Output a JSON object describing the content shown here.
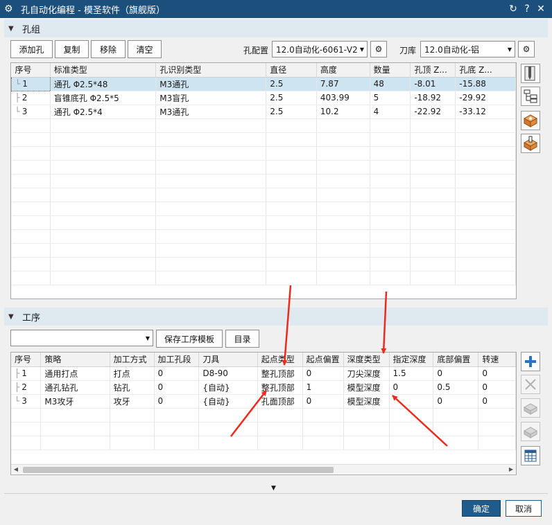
{
  "window": {
    "title": "孔自动化编程 - 模圣软件（旗舰版）",
    "app_icon": "gear-icon",
    "buttons": [
      "reset-icon",
      "help-icon",
      "close-icon"
    ]
  },
  "hole_group": {
    "section_label": "孔组",
    "buttons": {
      "add": "添加孔",
      "copy": "复制",
      "remove": "移除",
      "clear": "清空"
    },
    "config_label": "孔配置",
    "config_value": "12.0自动化-6061-V2",
    "tool_lib_label": "刀库",
    "tool_lib_value": "12.0自动化-铝",
    "columns": [
      "序号",
      "标准类型",
      "孔识别类型",
      "直径",
      "高度",
      "数量",
      "孔顶 Z...",
      "孔底 Z..."
    ],
    "rows": [
      [
        "1",
        "通孔 Φ2.5*48",
        "M3通孔",
        "2.5",
        "7.87",
        "48",
        "-8.01",
        "-15.88"
      ],
      [
        "2",
        "盲锥底孔 Φ2.5*5",
        "M3盲孔",
        "2.5",
        "403.99",
        "5",
        "-18.92",
        "-29.92"
      ],
      [
        "3",
        "通孔 Φ2.5*4",
        "M3通孔",
        "2.5",
        "10.2",
        "4",
        "-22.92",
        "-33.12"
      ]
    ],
    "selected_row": 0,
    "side_icons": [
      "hole-feature-icon",
      "list-tree-icon",
      "block-hole-icon",
      "block-tool-icon"
    ]
  },
  "process": {
    "section_label": "工序",
    "template_value": "",
    "buttons": {
      "save_template": "保存工序模板",
      "catalog": "目录"
    },
    "columns": [
      "序号",
      "策略",
      "加工方式",
      "加工孔段",
      "刀具",
      "起点类型",
      "起点偏置",
      "深度类型",
      "指定深度",
      "底部偏置",
      "转速"
    ],
    "rows": [
      [
        "1",
        "通用打点",
        "打点",
        "0",
        "D8-90",
        "整孔顶部",
        "0",
        "刀尖深度",
        "1.5",
        "0",
        "0"
      ],
      [
        "2",
        "通孔钻孔",
        "钻孔",
        "0",
        "{自动}",
        "整孔顶部",
        "1",
        "模型深度",
        "0",
        "0.5",
        "0"
      ],
      [
        "3",
        "M3攻牙",
        "攻牙",
        "0",
        "{自动}",
        "孔面顶部",
        "0",
        "模型深度",
        "",
        "0",
        "0"
      ]
    ],
    "side_icons": [
      "add-icon",
      "delete-icon",
      "block-up-icon",
      "block-down-icon",
      "table-icon"
    ]
  },
  "footer": {
    "ok": "确定",
    "cancel": "取消"
  },
  "colors": {
    "title_bar": "#1d4f7c",
    "section_header": "#dfe9f0",
    "selected_row": "#cfe4f1",
    "arrow": "#ee2a1c",
    "ok_button": "#1f5c8b"
  }
}
